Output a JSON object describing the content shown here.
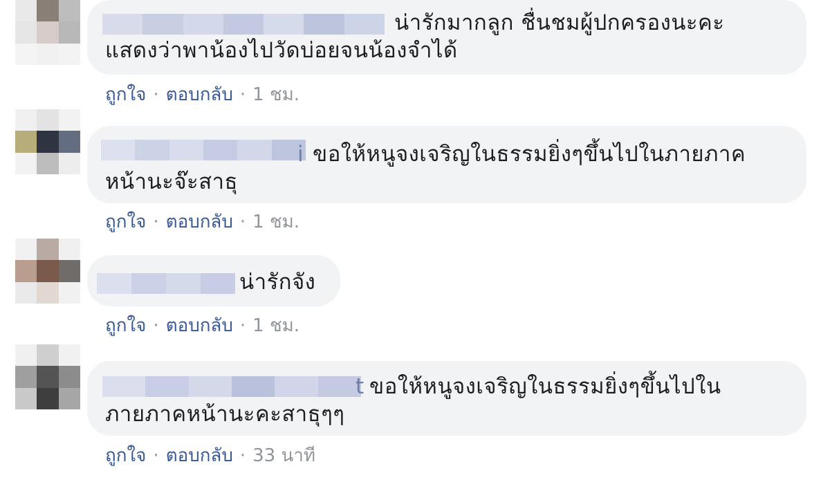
{
  "comments": [
    {
      "text_line1": "น่ารักมากลูก ชื่นชมผู้ปกครองนะคะ",
      "text_line2": "แสดงว่าพาน้องไปวัดบ่อยจนน้องจำได้",
      "like": "ถูกใจ",
      "reply": "ตอบกลับ",
      "time": "1 ชม."
    },
    {
      "name_tail": "i",
      "text_line1": "ขอให้หนูจงเจริญในธรรมยิ่งๆขึ้นไปในภายภาค",
      "text_line2": "หน้านะจ๊ะสาธุ",
      "like": "ถูกใจ",
      "reply": "ตอบกลับ",
      "time": "1 ชม."
    },
    {
      "text_line1": "น่ารักจัง",
      "like": "ถูกใจ",
      "reply": "ตอบกลับ",
      "time": "1 ชม."
    },
    {
      "name_tail": "t",
      "text_line1": "ขอให้หนูจงเจริญในธรรมยิ่งๆขึ้นไปใน",
      "text_line2": "ภายภาคหน้านะคะสาธุๆๆ",
      "like": "ถูกใจ",
      "reply": "ตอบกลับ",
      "time": "33 นาที"
    }
  ],
  "separator": "·",
  "colors": {
    "bubble_bg": "#f2f3f5",
    "text": "#1c1e21",
    "action_link": "#385898",
    "meta_gray": "#90949c"
  }
}
